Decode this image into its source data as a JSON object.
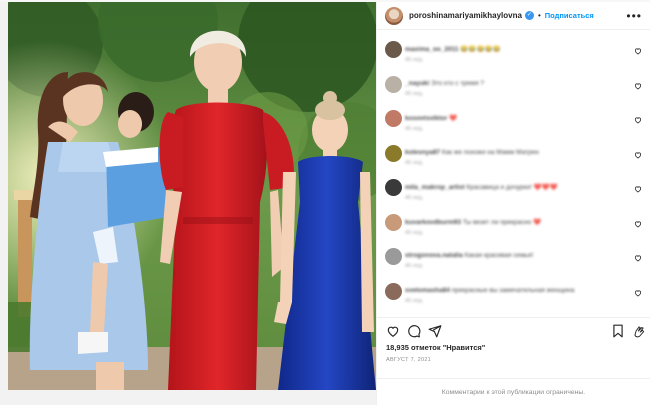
{
  "post": {
    "username": "poroshinamariyamikhaylovna",
    "verified_icon": "verified-check-icon",
    "separator": "•",
    "follow_label": "Подписаться",
    "more_icon": "ellipsis-icon"
  },
  "comments": [
    {
      "user": "maxima_oo_2011",
      "text": "😂😂😂😂😂",
      "meta": "46 нед.",
      "avatar_color": "#6b5a4a"
    },
    {
      "user": "_nayuki",
      "text": "Это кто с тремя ?",
      "meta": "46 нед.",
      "avatar_color": "#b9b0a6"
    },
    {
      "user": "kosovtsviktor",
      "text": "❤️",
      "meta": "46 нед.",
      "avatar_color": "#c07a66"
    },
    {
      "user": "kolesnya87",
      "text": "Как же похожи на Мамм Матрен",
      "meta": "46 нед.",
      "avatar_color": "#8a7a2a"
    },
    {
      "user": "mila_makrop_artist",
      "text": "Красавица и дочурки! ❤️❤️❤️",
      "meta": "46 нед.",
      "avatar_color": "#3a3a3a"
    },
    {
      "user": "kuvarkovdburm93",
      "text": "Ты везет ли прекрасно ❤️",
      "meta": "46 нед.",
      "avatar_color": "#c89a7a"
    },
    {
      "user": "strogonova.natalia",
      "text": "Какая красивая семья!",
      "meta": "46 нед.",
      "avatar_color": "#9a9a9a"
    },
    {
      "user": "svetomasha84",
      "text": "прекрасные вы замечательная женщина",
      "meta": "46 нед.",
      "avatar_color": "#8a6a5a"
    }
  ],
  "actions": {
    "like_icon": "heart-icon",
    "comment_icon": "comment-icon",
    "share_icon": "share-icon",
    "save_icon": "bookmark-icon"
  },
  "likes_text": "18,935 отметок \"Нравится\"",
  "date_text": "АВГУСТ 7, 2021",
  "restricted_text": "Комментарии к этой публикации ограничены.",
  "colors": {
    "accent": "#0095f6",
    "verified": "#3897f0",
    "text": "#262626",
    "muted": "#8e8e8e",
    "heart_red": "#ed4956"
  }
}
